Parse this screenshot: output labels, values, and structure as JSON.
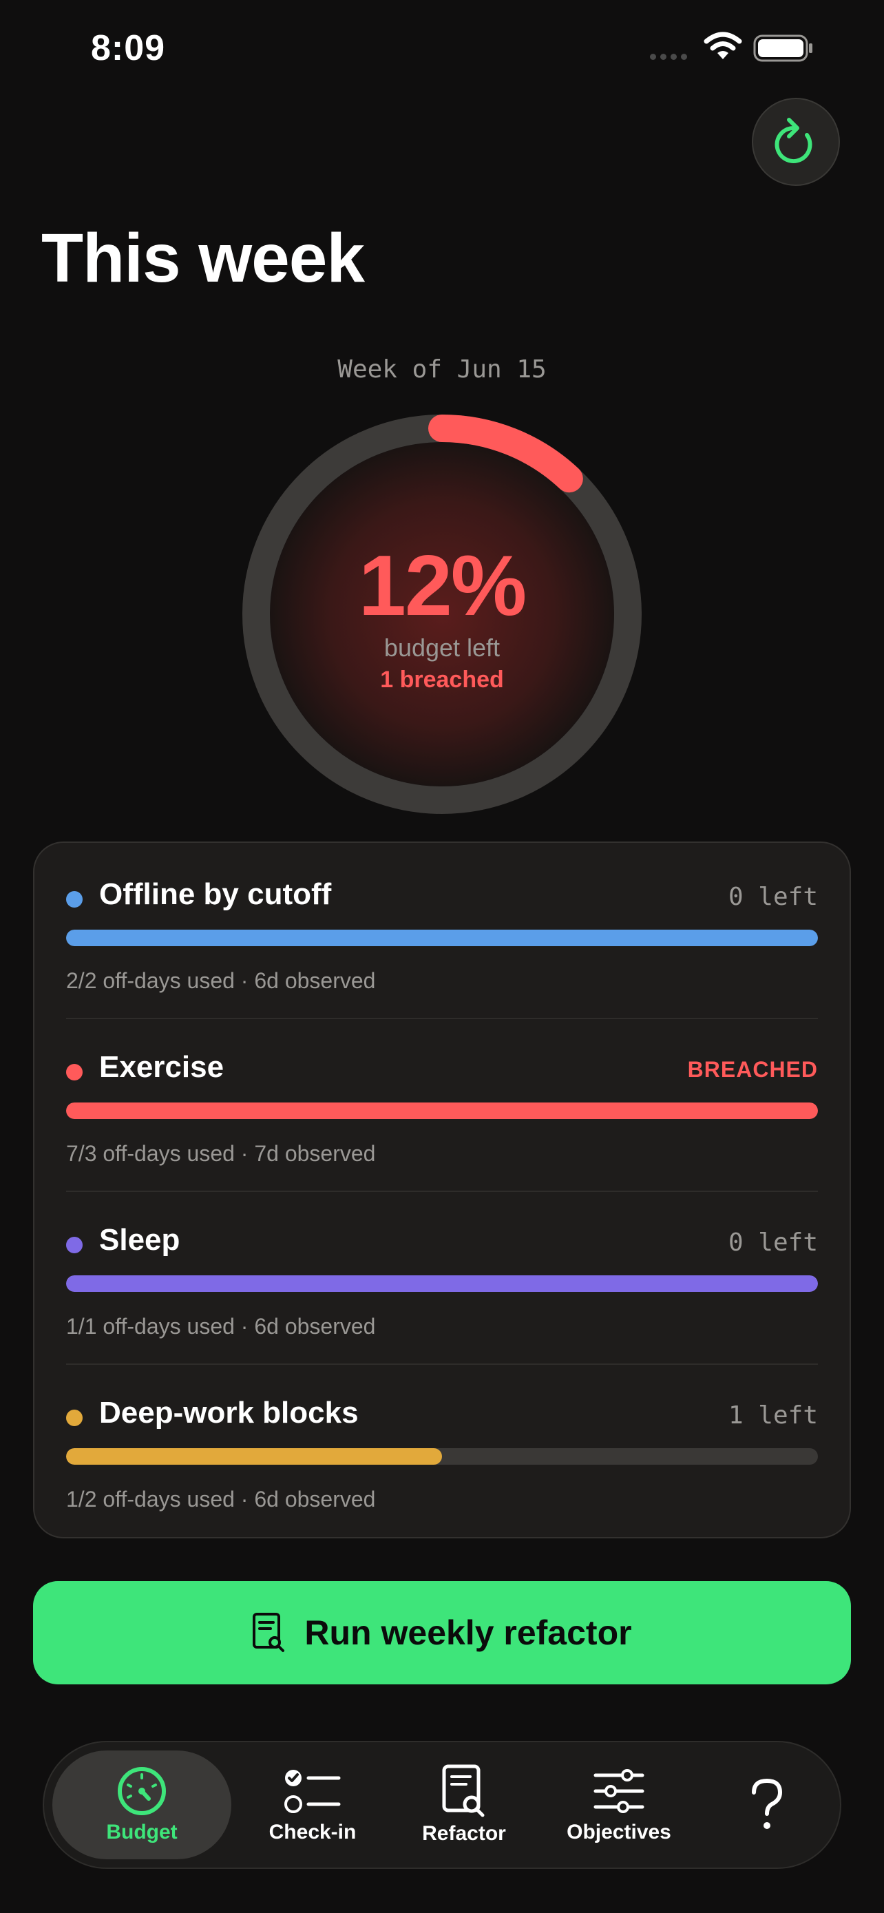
{
  "status_bar": {
    "time": "8:09"
  },
  "header": {
    "title": "This week"
  },
  "summary": {
    "week_label": "Week of Jun 15",
    "percent_text": "12%",
    "budget_left_fraction": 0.12,
    "budget_label": "budget left",
    "breached_text": "1 breached"
  },
  "objectives": [
    {
      "name": "Offline by cutoff",
      "status": "0 left",
      "breached": false,
      "meta": "2/2 off-days used · 6d observed",
      "color": "#5b9ee9",
      "fill_fraction": 1.0
    },
    {
      "name": "Exercise",
      "status": "BREACHED",
      "breached": true,
      "meta": "7/3 off-days used · 7d observed",
      "color": "#ff5a5a",
      "fill_fraction": 1.0
    },
    {
      "name": "Sleep",
      "status": "0 left",
      "breached": false,
      "meta": "1/1 off-days used · 6d observed",
      "color": "#7f6ae6",
      "fill_fraction": 1.0
    },
    {
      "name": "Deep-work blocks",
      "status": "1 left",
      "breached": false,
      "meta": "1/2 off-days used · 6d observed",
      "color": "#e2a93b",
      "fill_fraction": 0.5
    }
  ],
  "cta": {
    "label": "Run weekly refactor"
  },
  "tabs": [
    {
      "label": "Budget",
      "icon": "gauge-icon",
      "active": true
    },
    {
      "label": "Check-in",
      "icon": "checklist-icon",
      "active": false
    },
    {
      "label": "Refactor",
      "icon": "document-search-icon",
      "active": false
    },
    {
      "label": "Objectives",
      "icon": "sliders-icon",
      "active": false
    },
    {
      "label": "",
      "icon": "question-icon",
      "active": false
    }
  ],
  "colors": {
    "accent": "#3ee57a",
    "danger": "#ff5a5a",
    "track": "#3a3836"
  }
}
